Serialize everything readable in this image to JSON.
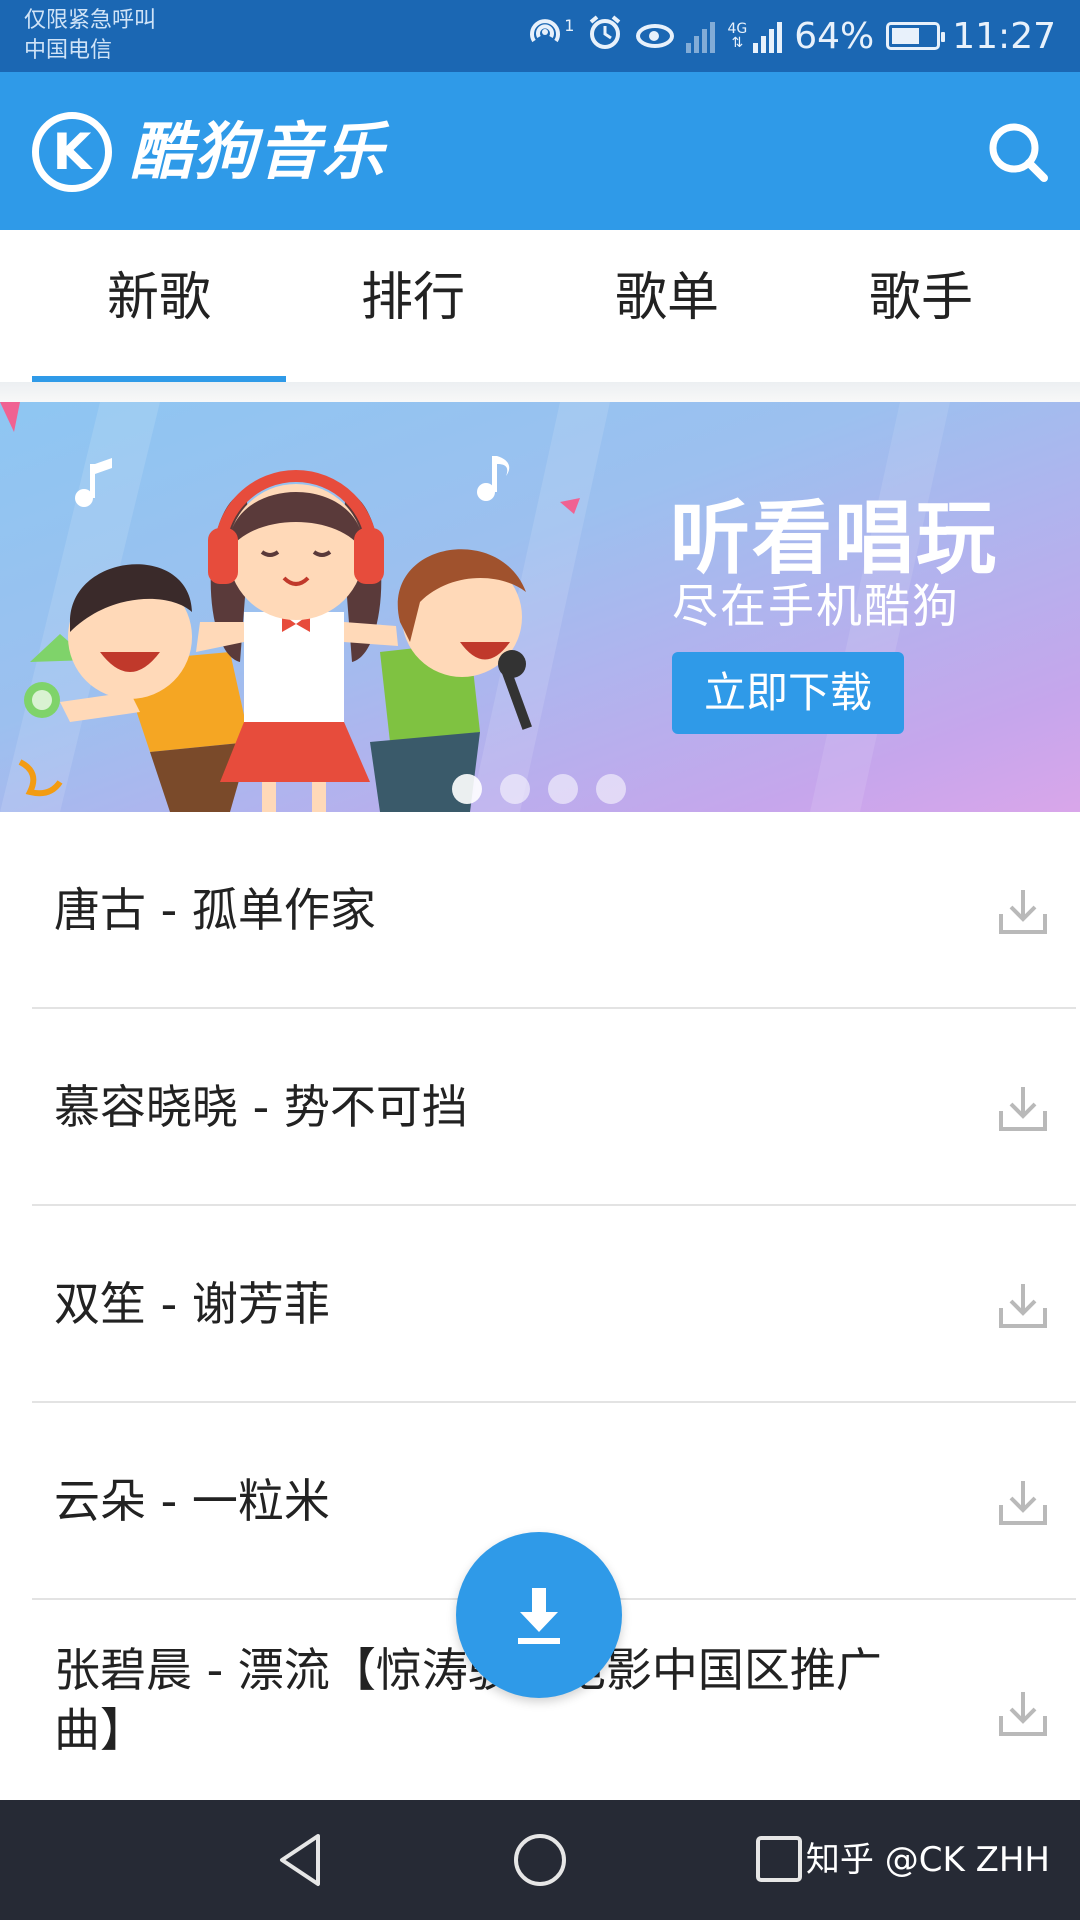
{
  "status_bar": {
    "line1": "仅限紧急呼叫",
    "line2": "中国电信",
    "hotspot_badge": "1",
    "network_type": "4G",
    "battery_text": "64%",
    "battery_level": 0.64,
    "time": "11:27",
    "icons": [
      "hotspot-icon",
      "alarm-icon",
      "eye-comfort-icon",
      "no-sim-signal-icon",
      "signal-icon",
      "battery-icon"
    ]
  },
  "app_bar": {
    "logo_letter": "K",
    "title": "酷狗音乐",
    "search_icon": "search-icon"
  },
  "tabs": [
    {
      "label": "新歌",
      "active": true
    },
    {
      "label": "排行",
      "active": false
    },
    {
      "label": "歌单",
      "active": false
    },
    {
      "label": "歌手",
      "active": false
    }
  ],
  "banner": {
    "headline": "听看唱玩",
    "subline": "尽在手机酷狗",
    "button_label": "立即下载",
    "page_count": 4,
    "active_page": 1
  },
  "songs": [
    {
      "title": "唐古 - 孤单作家"
    },
    {
      "title": "慕容晓晓 - 势不可挡"
    },
    {
      "title": "双笙 - 谢芳菲"
    },
    {
      "title": "云朵 - 一粒米"
    },
    {
      "title": "张碧晨 - 漂流【惊涛骇浪电影中国区推广曲】"
    }
  ],
  "fab_icon": "download-icon",
  "nav_bar": {
    "watermark": "知乎 @CK ZHH",
    "icons": [
      "back-icon",
      "home-icon",
      "recent-apps-icon"
    ]
  },
  "colors": {
    "status_bar": "#1b67b3",
    "brand_blue": "#2f9ae8",
    "nav_bar": "#262a35",
    "divider": "#e3e3e3"
  }
}
